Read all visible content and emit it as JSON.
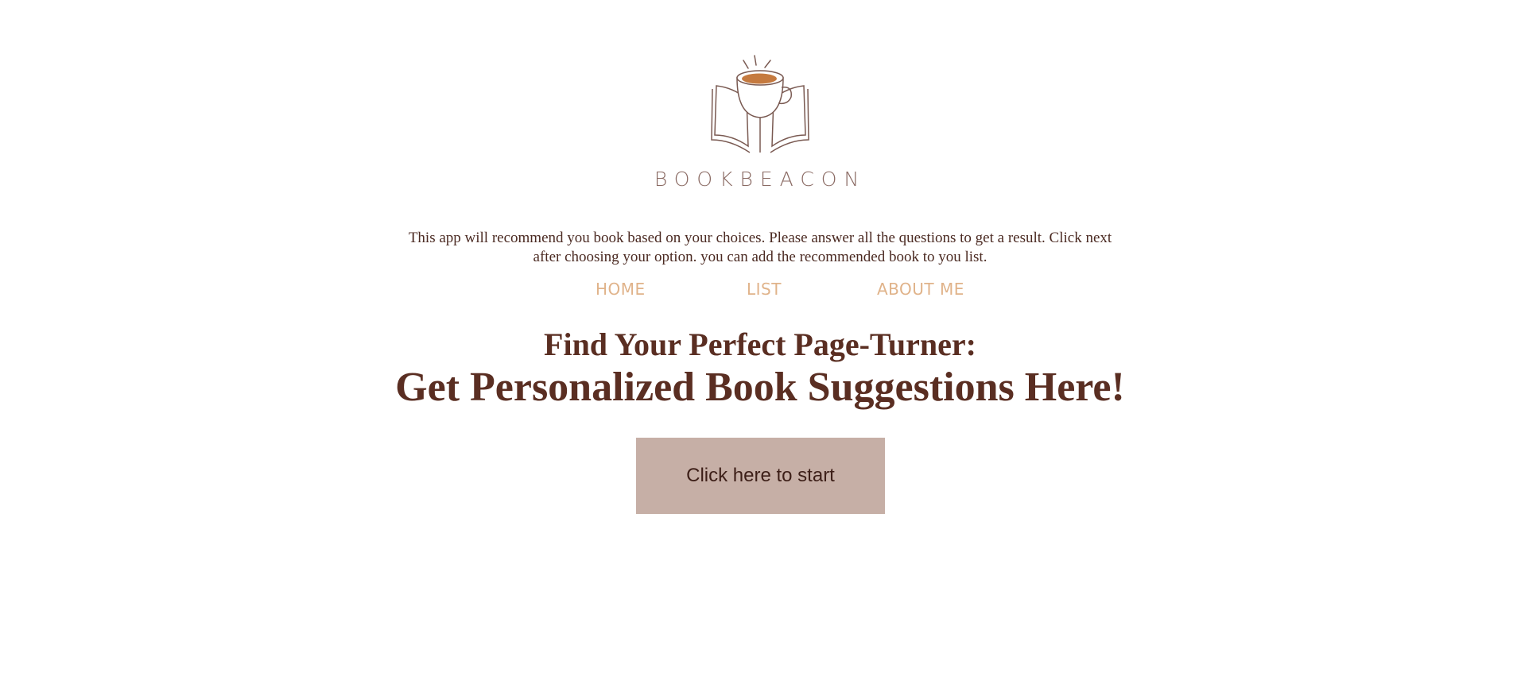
{
  "brand": {
    "name": "BOOKBEACON",
    "logo_icon": "coffee-book-icon",
    "accent_cup_color": "#c57a3f"
  },
  "intro": {
    "text": "This app will recommend you book based on your choices. Please answer all the questions to get a result. Click next after choosing your option. you can add the recommended book to you list."
  },
  "nav": {
    "home": "HOME",
    "list": "LIST",
    "about": "ABOUT ME"
  },
  "hero": {
    "line1": "Find Your Perfect Page-Turner:",
    "line2": "Get Personalized Book Suggestions Here!"
  },
  "cta": {
    "label": "Click here to start"
  },
  "colors": {
    "heading": "#5a2e22",
    "nav": "#e0b38a",
    "button_bg": "#c6afa6",
    "wordmark": "#8a6a63"
  }
}
